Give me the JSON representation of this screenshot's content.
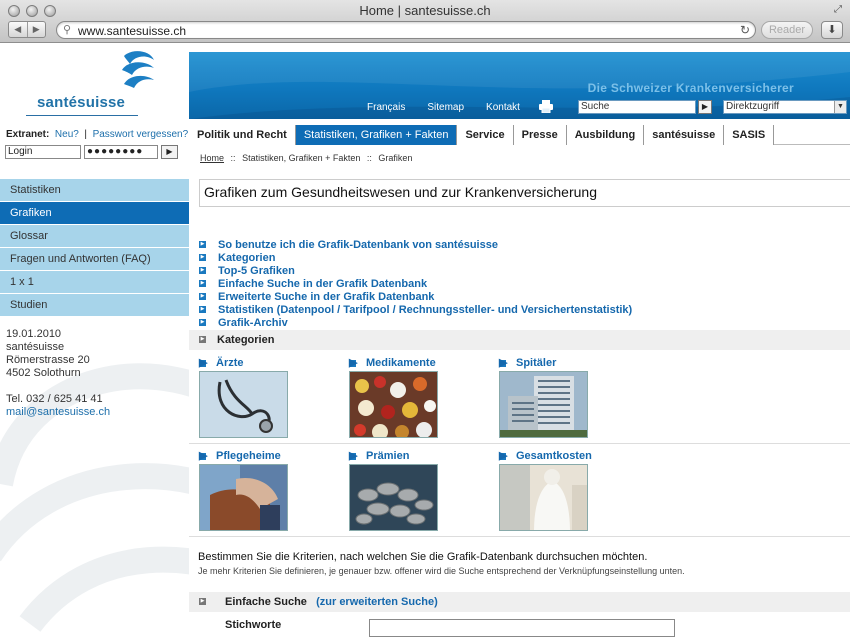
{
  "browser": {
    "title": "Home | santesuisse.ch",
    "url": "www.santesuisse.ch",
    "reader_label": "Reader"
  },
  "brand": {
    "logo_text": "santésuisse",
    "tagline": "Die Schweizer Krankenversicherer",
    "primary_color": "#0e6cb5",
    "light_color": "#a7d4ea"
  },
  "sidebar": {
    "extranet_label": "Extranet:",
    "new_link": "Neu?",
    "separator": "|",
    "forgot_link": "Passwort vergessen?",
    "login_placeholder": "Login",
    "password_mask": "●●●●●●●●",
    "go_symbol": "▶",
    "menu": [
      {
        "label": "Statistiken",
        "active": false
      },
      {
        "label": "Grafiken",
        "active": true
      },
      {
        "label": "Glossar",
        "active": false
      },
      {
        "label": "Fragen und Antworten (FAQ)",
        "active": false
      },
      {
        "label": "1 x 1",
        "active": false
      },
      {
        "label": "Studien",
        "active": false
      }
    ],
    "address": {
      "date": "19.01.2010",
      "org": "santésuisse",
      "street": "Römerstrasse 20",
      "city": "4502 Solothurn",
      "phone": "Tel. 032 / 625 41 41",
      "email": "mail@santesuisse.ch"
    }
  },
  "header": {
    "top_links": [
      "Français",
      "Sitemap",
      "Kontakt"
    ],
    "search_value": "Suche",
    "direkt_value": "Direktzugriff",
    "tabs": [
      {
        "label": "Politik und Recht",
        "active": false
      },
      {
        "label": "Statistiken, Grafiken + Fakten",
        "active": true
      },
      {
        "label": "Service",
        "active": false
      },
      {
        "label": "Presse",
        "active": false
      },
      {
        "label": "Ausbildung",
        "active": false
      },
      {
        "label": "santésuisse",
        "active": false
      },
      {
        "label": "SASIS",
        "active": false
      }
    ]
  },
  "content": {
    "breadcrumb": [
      "Home",
      "Statistiken, Grafiken + Fakten",
      "Grafiken"
    ],
    "breadcrumb_sep": "::",
    "headline": "Grafiken zum Gesundheitswesen und zur Krankenversicherung",
    "links": [
      "So benutze ich die Grafik-Datenbank von santésuisse",
      "Kategorien",
      "Top-5 Grafiken",
      "Einfache Suche in der Grafik Datenbank",
      "Erweiterte Suche in der Grafik Datenbank",
      "Statistiken (Datenpool / Tarifpool / Rechnungssteller- und Versichertenstatistik)",
      "Grafik-Archiv"
    ],
    "kategorien_title": "Kategorien",
    "categories": [
      {
        "label": "Ärzte"
      },
      {
        "label": "Medikamente"
      },
      {
        "label": "Spitäler"
      },
      {
        "label": "Pflegeheime"
      },
      {
        "label": "Prämien"
      },
      {
        "label": "Gesamtkosten"
      }
    ],
    "criteria_text": "Bestimmen Sie die Kriterien, nach welchen Sie die Grafik-Datenbank durchsuchen möchten.",
    "criteria_sub": "Je mehr Kriterien Sie definieren, je genauer bzw. offener wird die Suche entsprechend der Verknüpfungseinstellung unten.",
    "simple_search_title": "Einfache Suche",
    "advanced_link": "(zur erweiterten Suche)",
    "stichworte_label": "Stichworte"
  }
}
